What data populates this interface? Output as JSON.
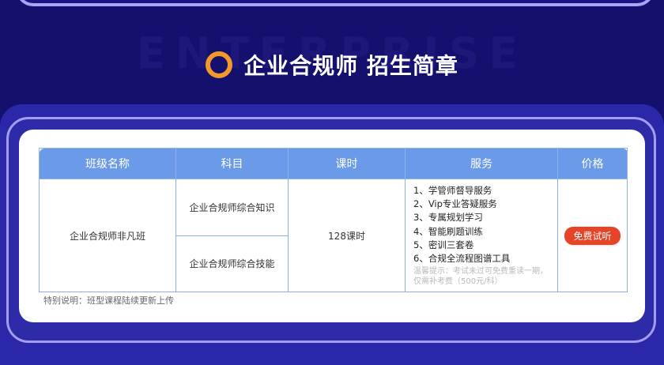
{
  "header": {
    "watermark": "ENTERPRISE",
    "title": "企业合规师 招生简章"
  },
  "table": {
    "columns": [
      "班级名称",
      "科目",
      "课时",
      "服务",
      "价格"
    ],
    "row": {
      "class_name": "企业合规师非凡班",
      "subjects": [
        "企业合规师综合知识",
        "企业合规师综合技能"
      ],
      "hours": "128课时",
      "services": [
        "1、学管师督导服务",
        "2、Vip专业答疑服务",
        "3、专属规划学习",
        "4、智能刷题训练",
        "5、密训三套卷",
        "6、合规全流程图谱工具"
      ],
      "tip": "温馨提示：考试未过可免费重读一期，仅需补考费（500元/科）",
      "price_button": "免费试听"
    }
  },
  "note": "特别说明：班型课程陆续更新上传",
  "colors": {
    "background": "#14106e",
    "accent_ring": "#f19a2a",
    "table_header": "#6b9be8",
    "button": "#e64426",
    "class_name": "#3f6fd6"
  }
}
